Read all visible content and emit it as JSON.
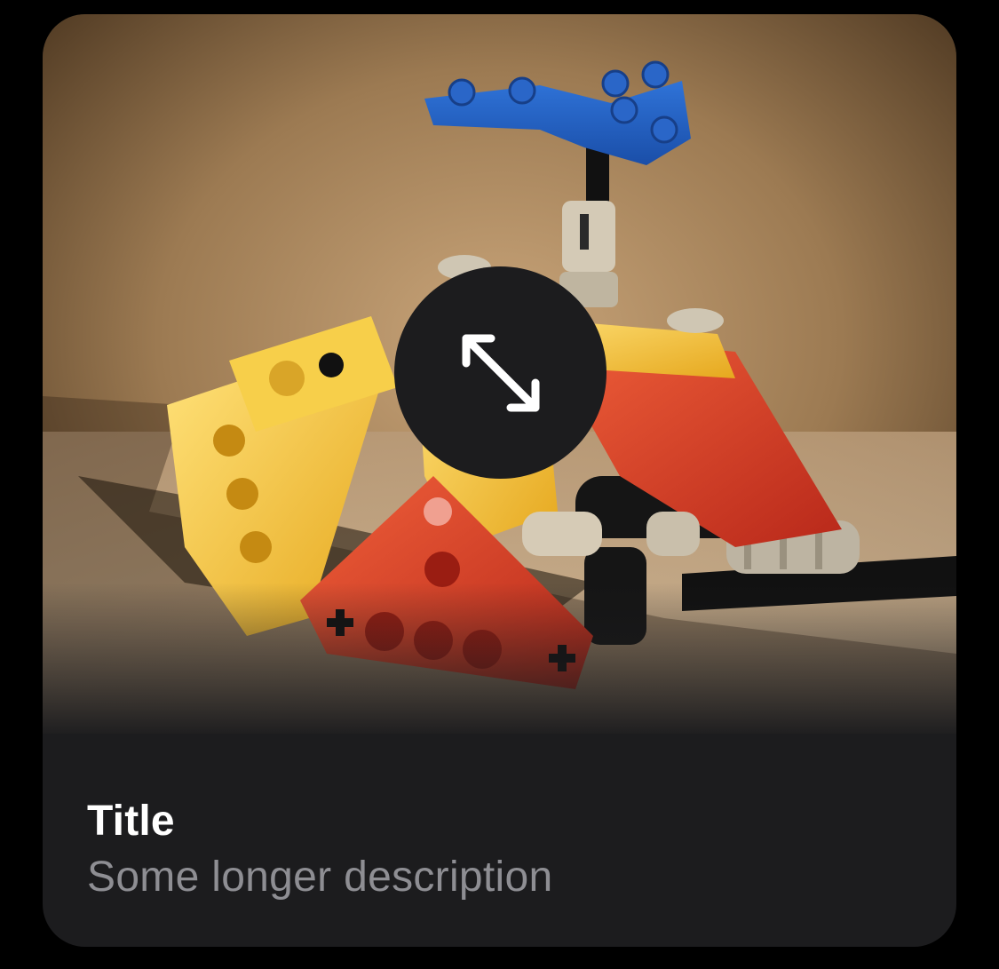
{
  "card": {
    "title": "Title",
    "description": "Some longer description"
  },
  "media": {
    "subject": "lego-technic-model-photo",
    "expand_icon": "arrows-expand-diagonal-icon"
  },
  "colors": {
    "page_background": "#000000",
    "card_background": "#1c1c1e",
    "title_text": "#ffffff",
    "description_text": "#8e8e93",
    "expand_button_background": "#1c1c1e",
    "expand_icon_color": "#ffffff"
  }
}
